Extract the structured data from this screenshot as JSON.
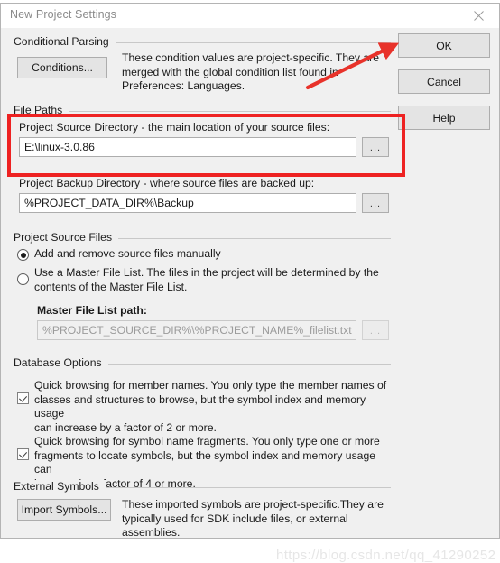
{
  "window": {
    "title": "New Project Settings",
    "close_icon": "close-icon"
  },
  "buttons": {
    "ok": "OK",
    "cancel": "Cancel",
    "help": "Help"
  },
  "conditional_parsing": {
    "group_title": "Conditional Parsing",
    "conditions_button": "Conditions...",
    "description": "These condition values are project-specific.  They are\nmerged with the global condition list found in\nPreferences: Languages."
  },
  "file_paths": {
    "group_title": "File Paths",
    "source_dir": {
      "label": "Project Source Directory - the main location of your source files:",
      "value": "E:\\linux-3.0.86",
      "browse_label": "..."
    },
    "backup_dir": {
      "label": "Project Backup Directory - where source files are backed up:",
      "value": "%PROJECT_DATA_DIR%\\Backup",
      "browse_label": "..."
    }
  },
  "project_source_files": {
    "group_title": "Project Source Files",
    "radio_manual": {
      "label": "Add and remove source files manually",
      "selected": true
    },
    "radio_master_list": {
      "label": "Use a Master File List. The files in the project will be determined by the\ncontents of the Master File List.",
      "selected": false
    },
    "master_path": {
      "label": "Master File List path:",
      "value": "%PROJECT_SOURCE_DIR%\\%PROJECT_NAME%_filelist.txt",
      "browse_label": "...",
      "disabled": true
    }
  },
  "database_options": {
    "group_title": "Database Options",
    "option_member_names": {
      "label": "Quick browsing for member names.  You only type the member names of\nclasses and structures to browse, but the symbol index and memory usage\ncan increase by a factor of 2 or more.",
      "checked": true
    },
    "option_name_fragments": {
      "label": "Quick browsing for symbol name fragments.  You only type one or more\nfragments to locate symbols, but the symbol index and memory usage can\nincrease by a factor of 4 or more.",
      "checked": true
    }
  },
  "external_symbols": {
    "group_title": "External Symbols",
    "import_button": "Import Symbols...",
    "description": "These imported symbols are project-specific.They are\ntypically used for SDK include files, or external assemblies."
  },
  "annotations": {
    "highlight_color": "#ee2222",
    "arrow_color": "#e8322a",
    "watermark": "https://blog.csdn.net/qq_41290252"
  }
}
